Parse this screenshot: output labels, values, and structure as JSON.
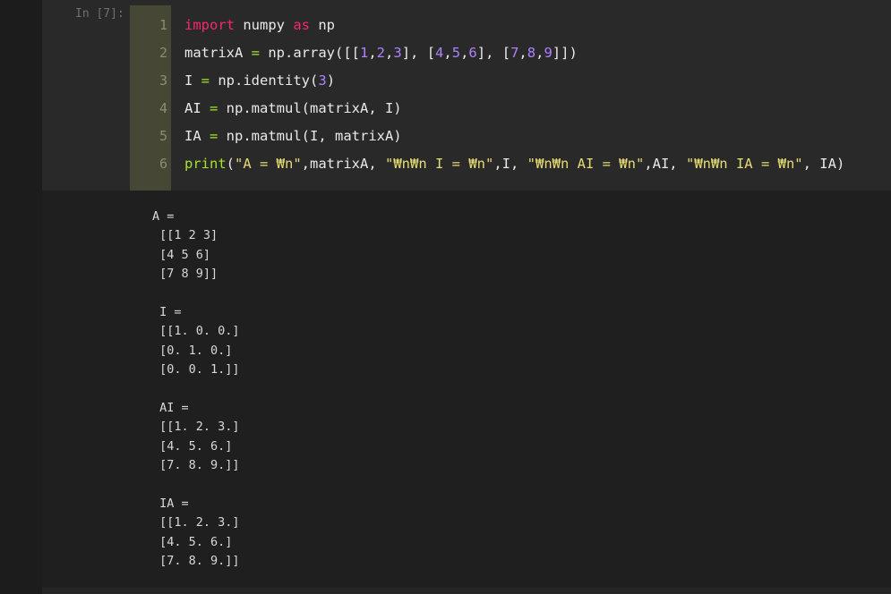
{
  "cell": {
    "prompt": "In [7]:",
    "line_numbers": [
      "1",
      "2",
      "3",
      "4",
      "5",
      "6"
    ],
    "code_lines": [
      [
        {
          "t": "import",
          "c": "kw"
        },
        {
          "t": " numpy ",
          "c": ""
        },
        {
          "t": "as",
          "c": "kw"
        },
        {
          "t": " np",
          "c": ""
        }
      ],
      [
        {
          "t": "matrixA ",
          "c": ""
        },
        {
          "t": "=",
          "c": "fn"
        },
        {
          "t": " np.array([[",
          "c": ""
        },
        {
          "t": "1",
          "c": "num"
        },
        {
          "t": ",",
          "c": ""
        },
        {
          "t": "2",
          "c": "num"
        },
        {
          "t": ",",
          "c": ""
        },
        {
          "t": "3",
          "c": "num"
        },
        {
          "t": "], [",
          "c": ""
        },
        {
          "t": "4",
          "c": "num"
        },
        {
          "t": ",",
          "c": ""
        },
        {
          "t": "5",
          "c": "num"
        },
        {
          "t": ",",
          "c": ""
        },
        {
          "t": "6",
          "c": "num"
        },
        {
          "t": "], [",
          "c": ""
        },
        {
          "t": "7",
          "c": "num"
        },
        {
          "t": ",",
          "c": ""
        },
        {
          "t": "8",
          "c": "num"
        },
        {
          "t": ",",
          "c": ""
        },
        {
          "t": "9",
          "c": "num"
        },
        {
          "t": "]])",
          "c": ""
        }
      ],
      [
        {
          "t": "I ",
          "c": ""
        },
        {
          "t": "=",
          "c": "fn"
        },
        {
          "t": " np.identity(",
          "c": ""
        },
        {
          "t": "3",
          "c": "num"
        },
        {
          "t": ")",
          "c": ""
        }
      ],
      [
        {
          "t": "AI ",
          "c": ""
        },
        {
          "t": "=",
          "c": "fn"
        },
        {
          "t": " np.matmul(matrixA, I)",
          "c": ""
        }
      ],
      [
        {
          "t": "IA ",
          "c": ""
        },
        {
          "t": "=",
          "c": "fn"
        },
        {
          "t": " np.matmul(I, matrixA)",
          "c": ""
        }
      ],
      [
        {
          "t": "print",
          "c": "fn"
        },
        {
          "t": "(",
          "c": ""
        },
        {
          "t": "\"A = ₩n\"",
          "c": "str"
        },
        {
          "t": ",matrixA, ",
          "c": ""
        },
        {
          "t": "\"₩n₩n I = ₩n\"",
          "c": "str"
        },
        {
          "t": ",I, ",
          "c": ""
        },
        {
          "t": "\"₩n₩n AI = ₩n\"",
          "c": "str"
        },
        {
          "t": ",AI, ",
          "c": ""
        },
        {
          "t": "\"₩n₩n IA = ₩n\"",
          "c": "str"
        },
        {
          "t": ", IA)",
          "c": ""
        }
      ]
    ]
  },
  "output": {
    "lines": [
      "A =",
      " [[1 2 3]",
      " [4 5 6]",
      " [7 8 9]]",
      "",
      " I =",
      " [[1. 0. 0.]",
      " [0. 1. 0.]",
      " [0. 0. 1.]]",
      "",
      " AI =",
      " [[1. 2. 3.]",
      " [4. 5. 6.]",
      " [7. 8. 9.]]",
      "",
      " IA =",
      " [[1. 2. 3.]",
      " [4. 5. 6.]",
      " [7. 8. 9.]]"
    ]
  },
  "colors": {
    "keyword": "#f92672",
    "number": "#ae81ff",
    "string": "#e6db74",
    "function": "#a6e22e"
  }
}
